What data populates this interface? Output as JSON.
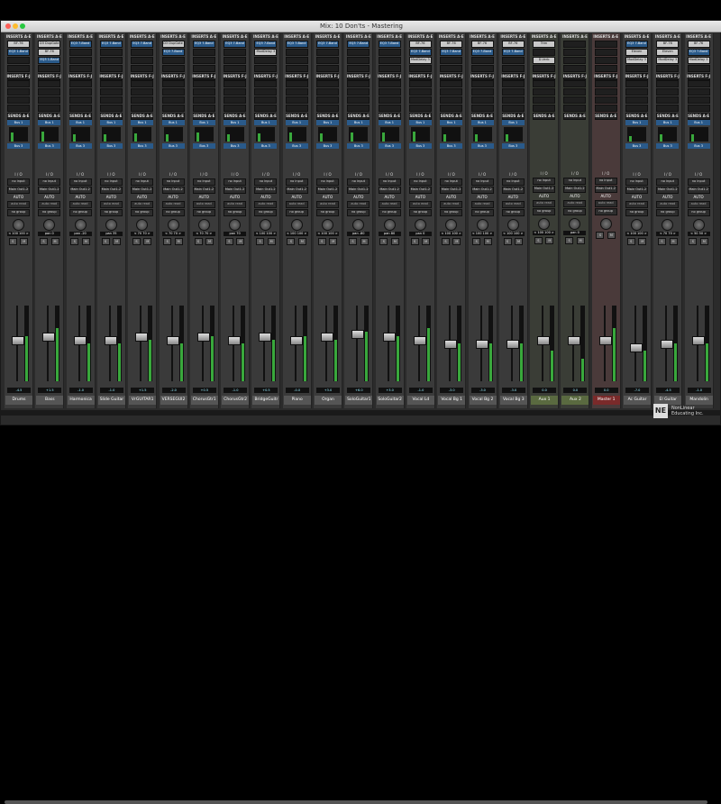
{
  "window": {
    "title": "Mix: 10 Don'ts - Mastering"
  },
  "logo": {
    "line1": "NonLinear",
    "line2": "Educating Inc."
  },
  "labels": {
    "inserts_ae": "INSERTS A-E",
    "inserts_fj": "INSERTS F-J",
    "sends_ae": "SENDS A-E",
    "io": "I / O",
    "auto": "AUTO",
    "auto_read": "auto read",
    "no_group": "no group",
    "no_input": "no input",
    "main_out": "Main Out1-2"
  },
  "strips": [
    {
      "name": "Drums",
      "inserts": [
        "BF-76",
        "EQ3 1-Band"
      ],
      "send": "Bus 1",
      "pan": "< 100  100 >",
      "vol": "-4.5",
      "meter": 0.6,
      "fader": 0.55
    },
    {
      "name": "Bass",
      "inserts": [
        "D3 DupGate",
        "BF-76",
        "EQ3 1-Band"
      ],
      "send": "Bus 1",
      "pan": "pan   0",
      "vol": "+1.5",
      "meter": 0.7,
      "fader": 0.6
    },
    {
      "name": "Harmonica",
      "inserts": [
        "EQ3 7-Band"
      ],
      "send": "Bus 1",
      "pan": "pan  -20",
      "vol": "-1.0",
      "meter": 0.5,
      "fader": 0.55
    },
    {
      "name": "Slide Guitar",
      "inserts": [
        "EQ3 7-Band"
      ],
      "send": "Bus 1",
      "pan": "pan  35",
      "vol": "-1.0",
      "meter": 0.5,
      "fader": 0.55
    },
    {
      "name": "VrGUITAR1",
      "inserts": [
        "EQ3 7-Band"
      ],
      "send": "Bus 1",
      "pan": "< 70  70 >",
      "vol": "+1.5",
      "meter": 0.55,
      "fader": 0.6
    },
    {
      "name": "VERSEGUI2",
      "inserts": [
        "D3 DupGate",
        "EQ3 7-Band"
      ],
      "send": "Bus 1",
      "pan": "< 70  70 >",
      "vol": "-2.0",
      "meter": 0.5,
      "fader": 0.55
    },
    {
      "name": "ChorusGtr1",
      "inserts": [
        "EQ3 7-Band"
      ],
      "send": "Bus 1",
      "pan": "< 70  70 >",
      "vol": "+0.5",
      "meter": 0.6,
      "fader": 0.6
    },
    {
      "name": "ChorusGtr2",
      "inserts": [
        "EQ3 7-Band"
      ],
      "send": "Bus 1",
      "pan": "pan  70",
      "vol": "-1.0",
      "meter": 0.5,
      "fader": 0.55
    },
    {
      "name": "BridgeGuitr",
      "inserts": [
        "EQ3 7-Band",
        "ModDelay 3"
      ],
      "send": "Bus 1",
      "pan": "< 100  100 >",
      "vol": "+0.5",
      "meter": 0.55,
      "fader": 0.6
    },
    {
      "name": "Piano",
      "inserts": [
        "EQ3 7-Band"
      ],
      "send": "Bus 1",
      "pan": "< 100  100 >",
      "vol": "-0.0",
      "meter": 0.6,
      "fader": 0.55
    },
    {
      "name": "Organ",
      "inserts": [
        "EQ3 7-Band"
      ],
      "send": "Bus 1",
      "pan": "< 100  100 >",
      "vol": "+3.0",
      "meter": 0.55,
      "fader": 0.6
    },
    {
      "name": "SoloGuitar1",
      "inserts": [
        "EQ3 7-Band"
      ],
      "send": "Bus 1",
      "pan": "pan  -80",
      "vol": "+6.0",
      "meter": 0.65,
      "fader": 0.65
    },
    {
      "name": "SoloGuitar2",
      "inserts": [
        "EQ3 7-Band"
      ],
      "send": "Bus 1",
      "pan": "pan  80",
      "vol": "+3.0",
      "meter": 0.6,
      "fader": 0.6
    },
    {
      "name": "Vocal Ld",
      "inserts": [
        "BF-76",
        "EQ3 7-Band",
        "ModDelay 3"
      ],
      "send": "Bus 1",
      "pan": "pan   0",
      "vol": "-1.0",
      "meter": 0.7,
      "fader": 0.55
    },
    {
      "name": "Vocal Bg 1",
      "inserts": [
        "BF-76",
        "EQ3 7-Band"
      ],
      "send": "Bus 1",
      "pan": "< 100  100 >",
      "vol": "-3.0",
      "meter": 0.5,
      "fader": 0.5
    },
    {
      "name": "Vocal Bg 2",
      "inserts": [
        "BF-76",
        "EQ3 7-Band"
      ],
      "send": "Bus 1",
      "pan": "< 100  100 >",
      "vol": "-3.0",
      "meter": 0.5,
      "fader": 0.5
    },
    {
      "name": "Vocal Bg 3",
      "inserts": [
        "BF-76",
        "EQ3 7-Band"
      ],
      "send": "Bus 1",
      "pan": "< 100  100 >",
      "vol": "-3.0",
      "meter": 0.5,
      "fader": 0.5
    },
    {
      "name": "Aux 1",
      "inserts": [
        "Trim",
        "",
        "D-Verb"
      ],
      "send": "",
      "pan": "< 100  100 >",
      "vol": "0.0",
      "meter": 0.4,
      "fader": 0.55,
      "type": "aux"
    },
    {
      "name": "Aux 2",
      "inserts": [],
      "send": "",
      "pan": "pan   0",
      "vol": "0.0",
      "meter": 0.3,
      "fader": 0.55,
      "type": "aux"
    },
    {
      "name": "Master 1",
      "inserts": [],
      "send": "",
      "pan": "",
      "vol": "0.0",
      "meter": 0.7,
      "fader": 0.55,
      "type": "master"
    },
    {
      "name": "Ac Guitar",
      "inserts": [
        "EQ3 7-Band",
        "Eleven",
        "ModDelay 3"
      ],
      "send": "Bus 1",
      "pan": "< 100  100 >",
      "vol": "-7.0",
      "meter": 0.4,
      "fader": 0.45
    },
    {
      "name": "El Guitar",
      "inserts": [
        "BF-76",
        "Eleven",
        "ModDelay 3"
      ],
      "send": "Bus 1",
      "pan": "< 70  70 >",
      "vol": "-4.5",
      "meter": 0.5,
      "fader": 0.5
    },
    {
      "name": "Mandolin",
      "inserts": [
        "BF-76",
        "EQ3 7-Band",
        "ModDelay 3"
      ],
      "send": "Bus 1",
      "pan": "< 50  50 >",
      "vol": "-1.0",
      "meter": 0.5,
      "fader": 0.55
    }
  ]
}
